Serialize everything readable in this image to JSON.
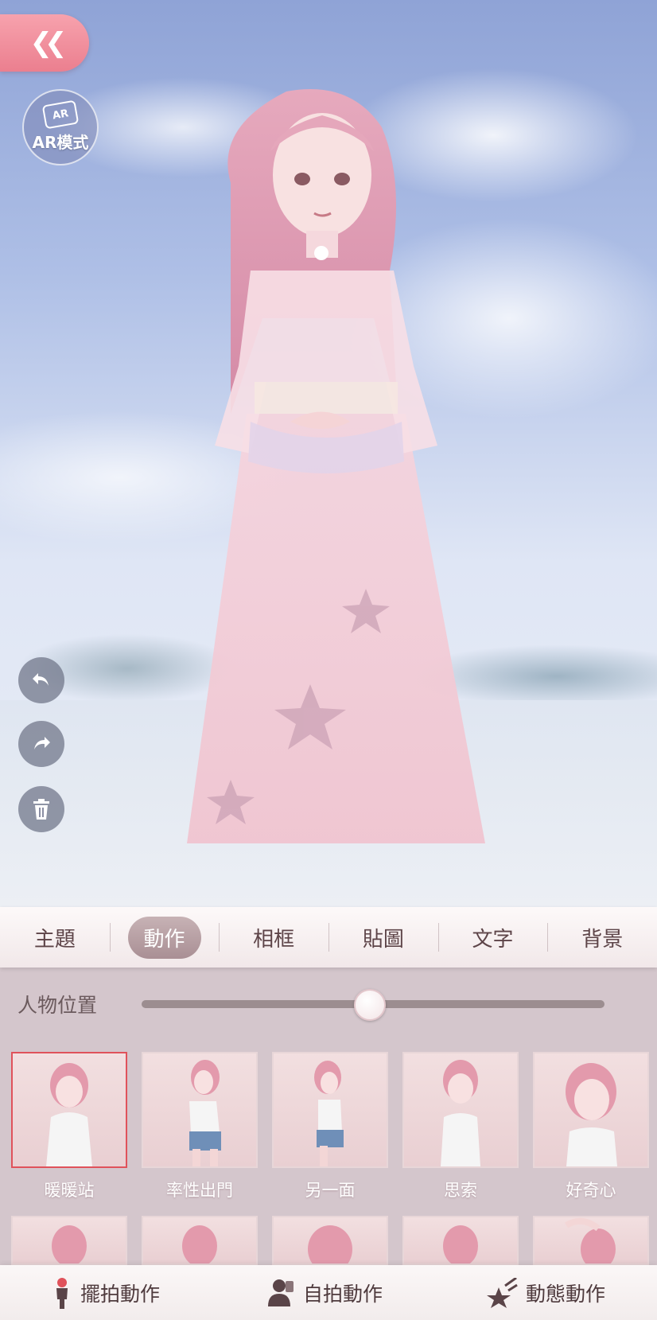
{
  "top_controls": {
    "back_icon": "double-chevron-left-icon",
    "ar": {
      "badge": "AR",
      "label": "AR模式"
    }
  },
  "side_tools": [
    {
      "name": "undo",
      "icon": "undo-arrow-icon"
    },
    {
      "name": "redo",
      "icon": "redo-arrow-icon"
    },
    {
      "name": "delete",
      "icon": "trash-icon"
    }
  ],
  "tabs": [
    {
      "label": "主題",
      "active": false
    },
    {
      "label": "動作",
      "active": true
    },
    {
      "label": "相框",
      "active": false
    },
    {
      "label": "貼圖",
      "active": false
    },
    {
      "label": "文字",
      "active": false
    },
    {
      "label": "背景",
      "active": false
    }
  ],
  "position": {
    "label": "人物位置",
    "value": 0.49
  },
  "poses_row1": [
    {
      "label": "暖暖站",
      "selected": true
    },
    {
      "label": "率性出門",
      "selected": false
    },
    {
      "label": "另一面",
      "selected": false
    },
    {
      "label": "思索",
      "selected": false
    },
    {
      "label": "好奇心",
      "selected": false
    }
  ],
  "bottom_modes": [
    {
      "label": "擺拍動作",
      "icon": "standing-figure-icon"
    },
    {
      "label": "自拍動作",
      "icon": "selfie-person-icon"
    },
    {
      "label": "動態動作",
      "icon": "shooting-star-icon"
    }
  ],
  "colors": {
    "accent": "#eb7f8f",
    "selected_border": "#e0525b",
    "active_tab": "#a98f94"
  }
}
